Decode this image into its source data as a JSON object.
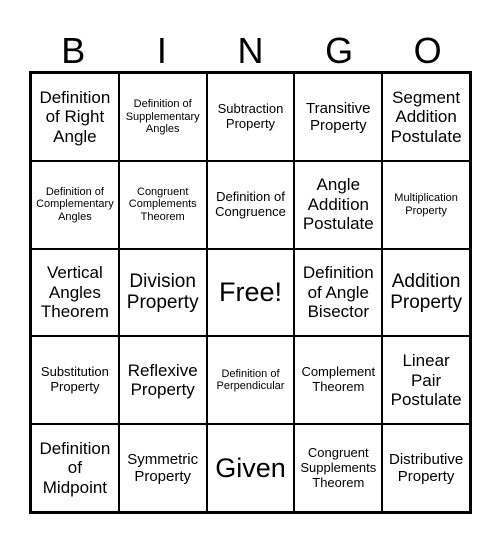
{
  "header": {
    "letters": [
      "B",
      "I",
      "N",
      "G",
      "O"
    ]
  },
  "cells": [
    "Definition of Right Angle",
    "Definition of Supplementary Angles",
    "Subtraction Property",
    "Transitive Property",
    "Segment Addition Postulate",
    "Definition of Complementary Angles",
    "Congruent Complements Theorem",
    "Definition of Congruence",
    "Angle Addition Postulate",
    "Multiplication Property",
    "Vertical Angles Theorem",
    "Division Property",
    "Free!",
    "Definition of Angle Bisector",
    "Addition Property",
    "Substitution Property",
    "Reflexive Property",
    "Definition of Perpendicular",
    "Complement Theorem",
    "Linear Pair Postulate",
    "Definition of Midpoint",
    "Symmetric Property",
    "Given",
    "Congruent Supplements Theorem",
    "Distributive Property"
  ]
}
